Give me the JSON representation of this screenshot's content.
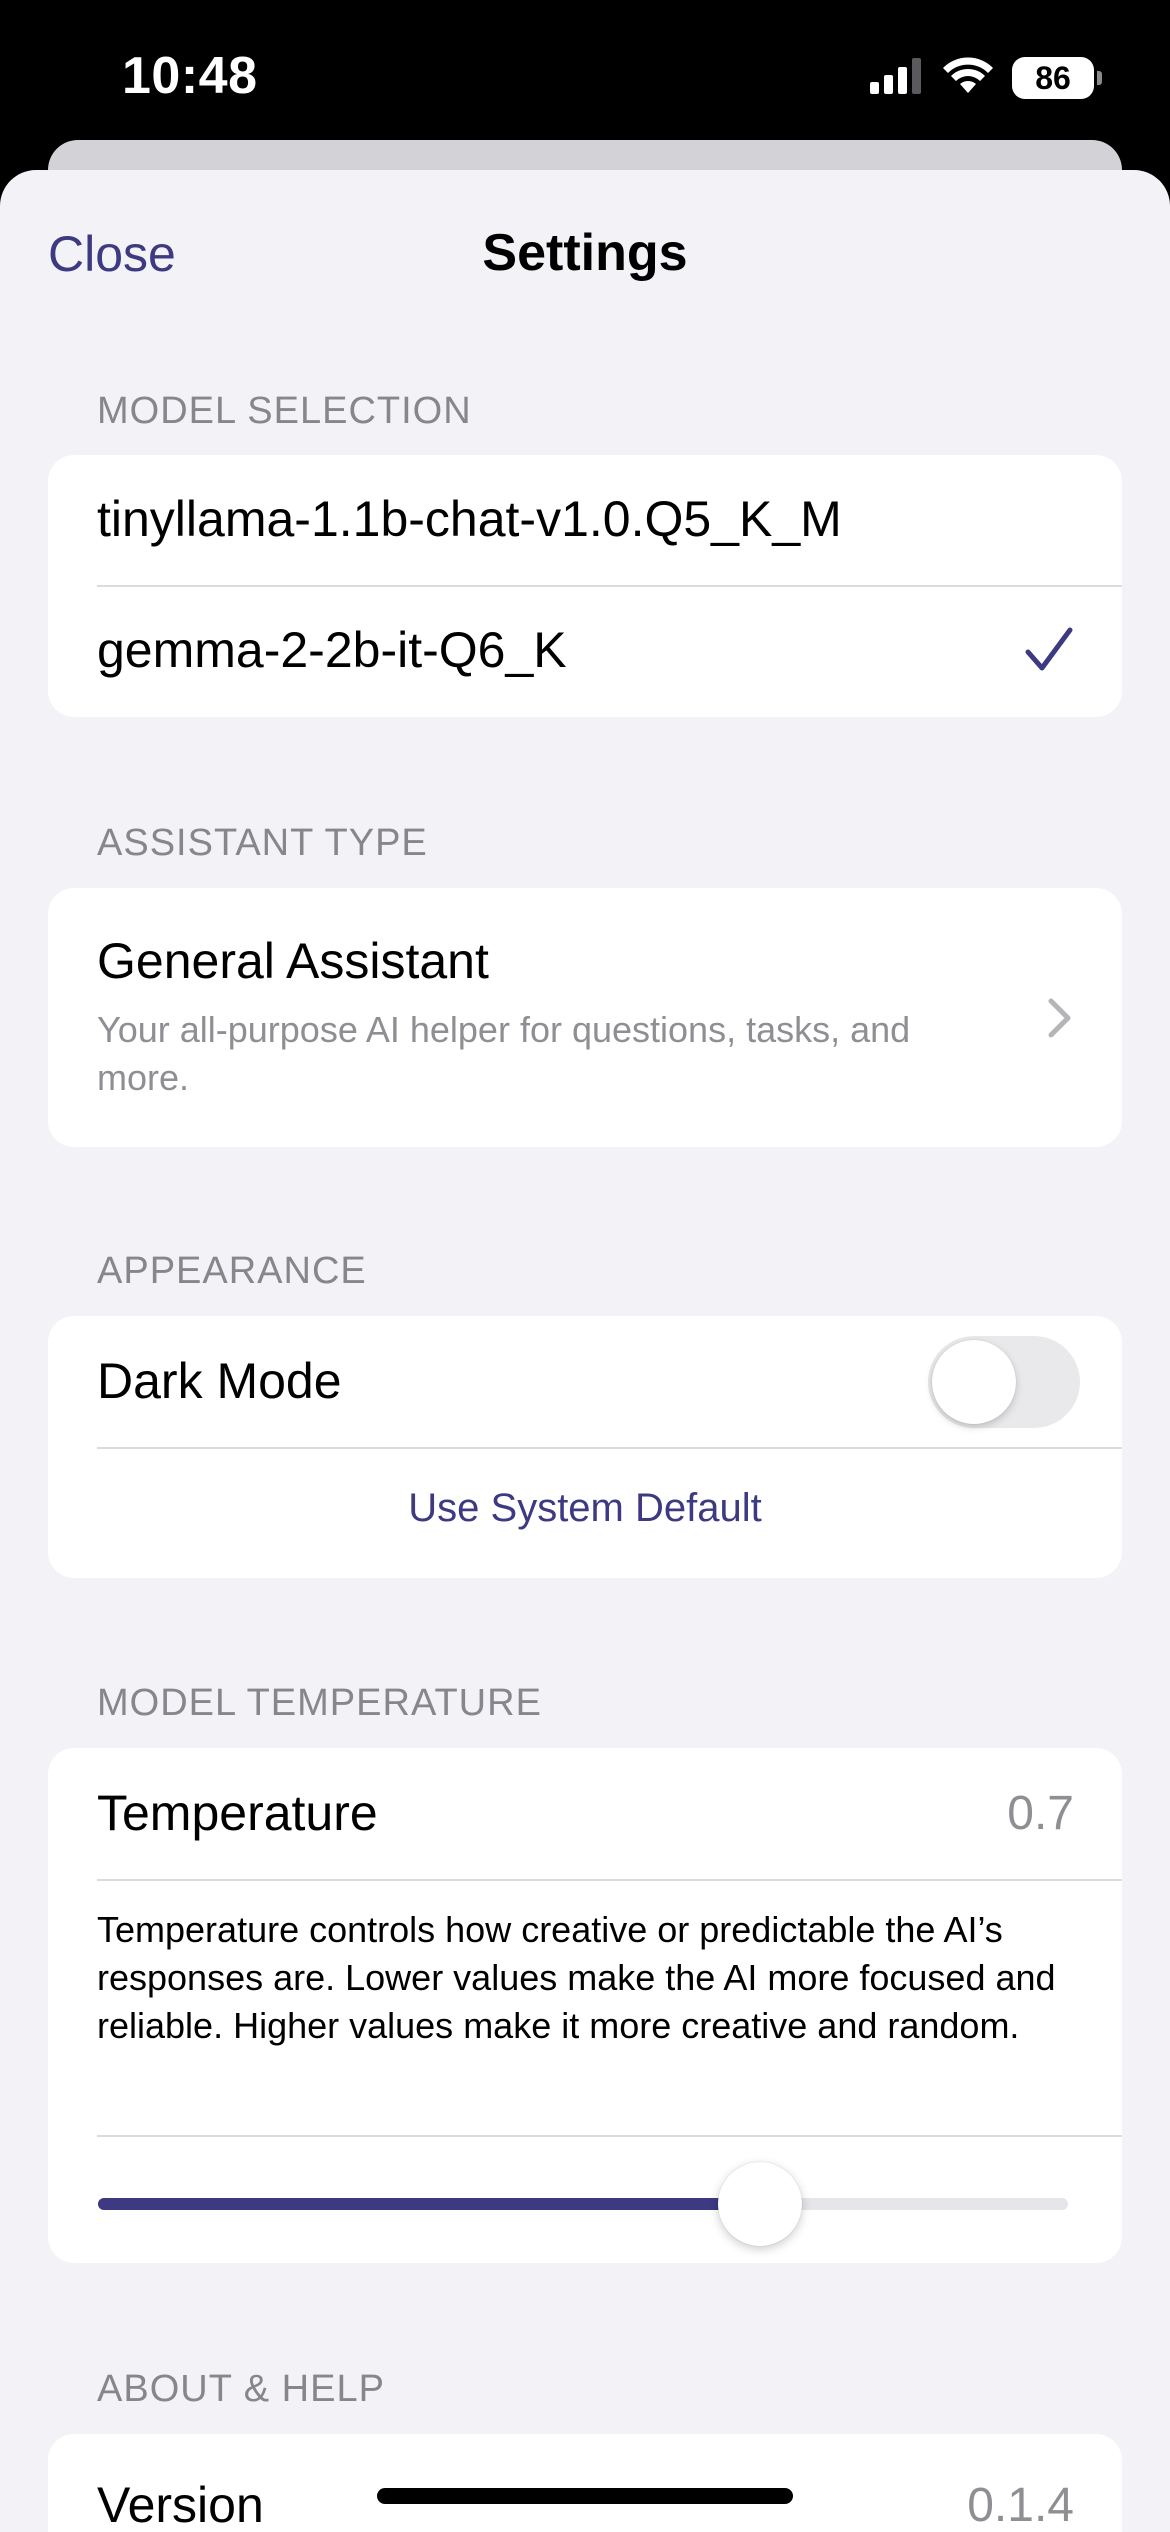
{
  "status_bar": {
    "time": "10:48",
    "battery": "86"
  },
  "nav": {
    "close_label": "Close",
    "title": "Settings"
  },
  "model_selection": {
    "header": "MODEL SELECTION",
    "items": [
      {
        "label": "tinyllama-1.1b-chat-v1.0.Q5_K_M",
        "selected": false
      },
      {
        "label": "gemma-2-2b-it-Q6_K",
        "selected": true
      }
    ]
  },
  "assistant_type": {
    "header": "ASSISTANT TYPE",
    "title": "General Assistant",
    "description": "Your all-purpose AI helper for questions, tasks, and more."
  },
  "appearance": {
    "header": "APPEARANCE",
    "dark_mode_label": "Dark Mode",
    "dark_mode_on": false,
    "system_default_label": "Use System Default"
  },
  "model_temperature": {
    "header": "MODEL TEMPERATURE",
    "label": "Temperature",
    "value": "0.7",
    "description": "Temperature controls how creative or predictable the AI’s responses are. Lower values make the AI more focused and reliable. Higher values make it more creative and random.",
    "slider_fraction": 0.682
  },
  "about": {
    "header": "ABOUT & HELP",
    "version_label": "Version",
    "version_value": "0.1.4"
  },
  "colors": {
    "accent": "#3d3a82",
    "background": "#f2f2f7",
    "secondary_text": "#8e8e93"
  }
}
